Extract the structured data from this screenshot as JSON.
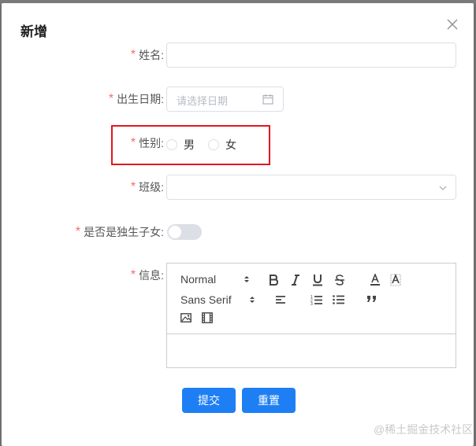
{
  "dialog": {
    "title": "新增",
    "close_icon": "close-icon"
  },
  "form": {
    "name": {
      "label": "姓名:",
      "required": "*",
      "value": ""
    },
    "birthday": {
      "label": "出生日期:",
      "required": "*",
      "placeholder": "请选择日期"
    },
    "gender": {
      "label": "性别:",
      "required": "*",
      "options": [
        "男",
        "女"
      ]
    },
    "class": {
      "label": "班级:",
      "required": "*",
      "value": ""
    },
    "only_child": {
      "label": "是否是独生子女:",
      "required": "*",
      "value": false
    },
    "info": {
      "label": "信息:",
      "required": "*",
      "header_select": "Normal",
      "font_select": "Sans Serif",
      "tools": [
        "bold",
        "italic",
        "underline",
        "strike",
        "color",
        "background",
        "align",
        "ordered-list",
        "bullet-list",
        "blockquote",
        "image",
        "video"
      ]
    }
  },
  "buttons": {
    "submit": "提交",
    "reset": "重置"
  },
  "watermark": "@稀土掘金技术社区",
  "colors": {
    "primary": "#1e7ff5",
    "required": "#f56c6c",
    "highlight": "#e4161e"
  }
}
